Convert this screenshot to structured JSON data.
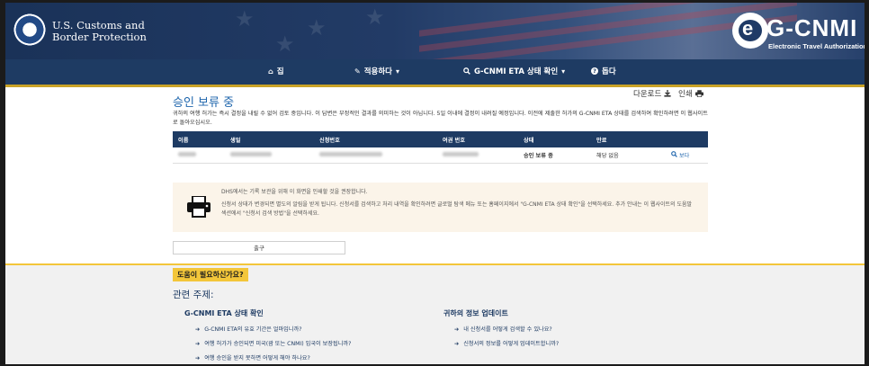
{
  "header": {
    "agency_line1": "U.S. Customs and",
    "agency_line2": "Border Protection",
    "logo_mark": "e",
    "logo_text": "G-CNMI",
    "logo_subtitle": "Electronic Travel Authorization"
  },
  "nav": {
    "home": "집",
    "apply": "적용하다",
    "status": "G-CNMI ETA 상태 확인",
    "help": "돕다"
  },
  "main": {
    "title": "승인 보류 중",
    "download_label": "다운로드",
    "print_label": "인쇄",
    "intro": "귀하의 여행 허가는 즉시 결정을 내릴 수 없어 검토 중입니다. 이 답변은 부정적인 결과를 의미하는 것이 아닙니다. 5일 이내에 결정이 내려질 예정입니다. 이전에 제출한 허가의 G-CNMI ETA 상태를 검색하여 확인하려면 이 웹사이트로 돌아오십시오.",
    "table": {
      "headers": [
        "이름",
        "생일",
        "신청번호",
        "여권 번호",
        "상태",
        "만료"
      ],
      "row": {
        "status": "승인 보류 중",
        "expiry": "해당 없음",
        "view": "보다"
      }
    },
    "notice": {
      "line1": "DHS에서는 기록 보관을 위해 이 화면을 인쇄할 것을 권장합니다.",
      "line2": "신청서 상태가 변경되면 별도의 알림을 받게 됩니다. 신청서를 검색하고 처리 내역을 확인하려면 글로벌 탐색 메뉴 또는 홈페이지에서 \"G-CNMI ETA 상태 확인\"을 선택하세요. 추가 안내는 이 웹사이트의 도움말 섹션에서 \"신청서 검색 방법\"을 선택하세요."
    },
    "exit_label": "출구"
  },
  "help": {
    "tab": "도움이 필요하신가요?",
    "related": "관련 주제:",
    "col1": {
      "title": "G-CNMI ETA 상태 확인",
      "items": [
        "G-CNMI ETA의 유효 기간은 얼마입니까?",
        "여행 허가가 승인되면 미국(괌 또는 CNMI) 입국이 보장됩니까?",
        "여행 승인을 받지 못하면 어떻게 해야 하나요?"
      ]
    },
    "col2": {
      "title": "귀하의 정보 업데이트",
      "items": [
        "내 신청서를 어떻게 검색할 수 있나요?",
        "신청서의 정보를 어떻게 업데이트합니까?"
      ]
    }
  },
  "colors": {
    "navy": "#1e3b63",
    "link_blue": "#1f66ad",
    "gold": "#f3c63a",
    "notice_bg": "#fbf4e9"
  },
  "icons": [
    "dhs-seal-icon",
    "home-icon",
    "pencil-icon",
    "search-icon",
    "question-icon",
    "download-icon",
    "print-icon",
    "printer-icon",
    "arrow-right-icon"
  ]
}
